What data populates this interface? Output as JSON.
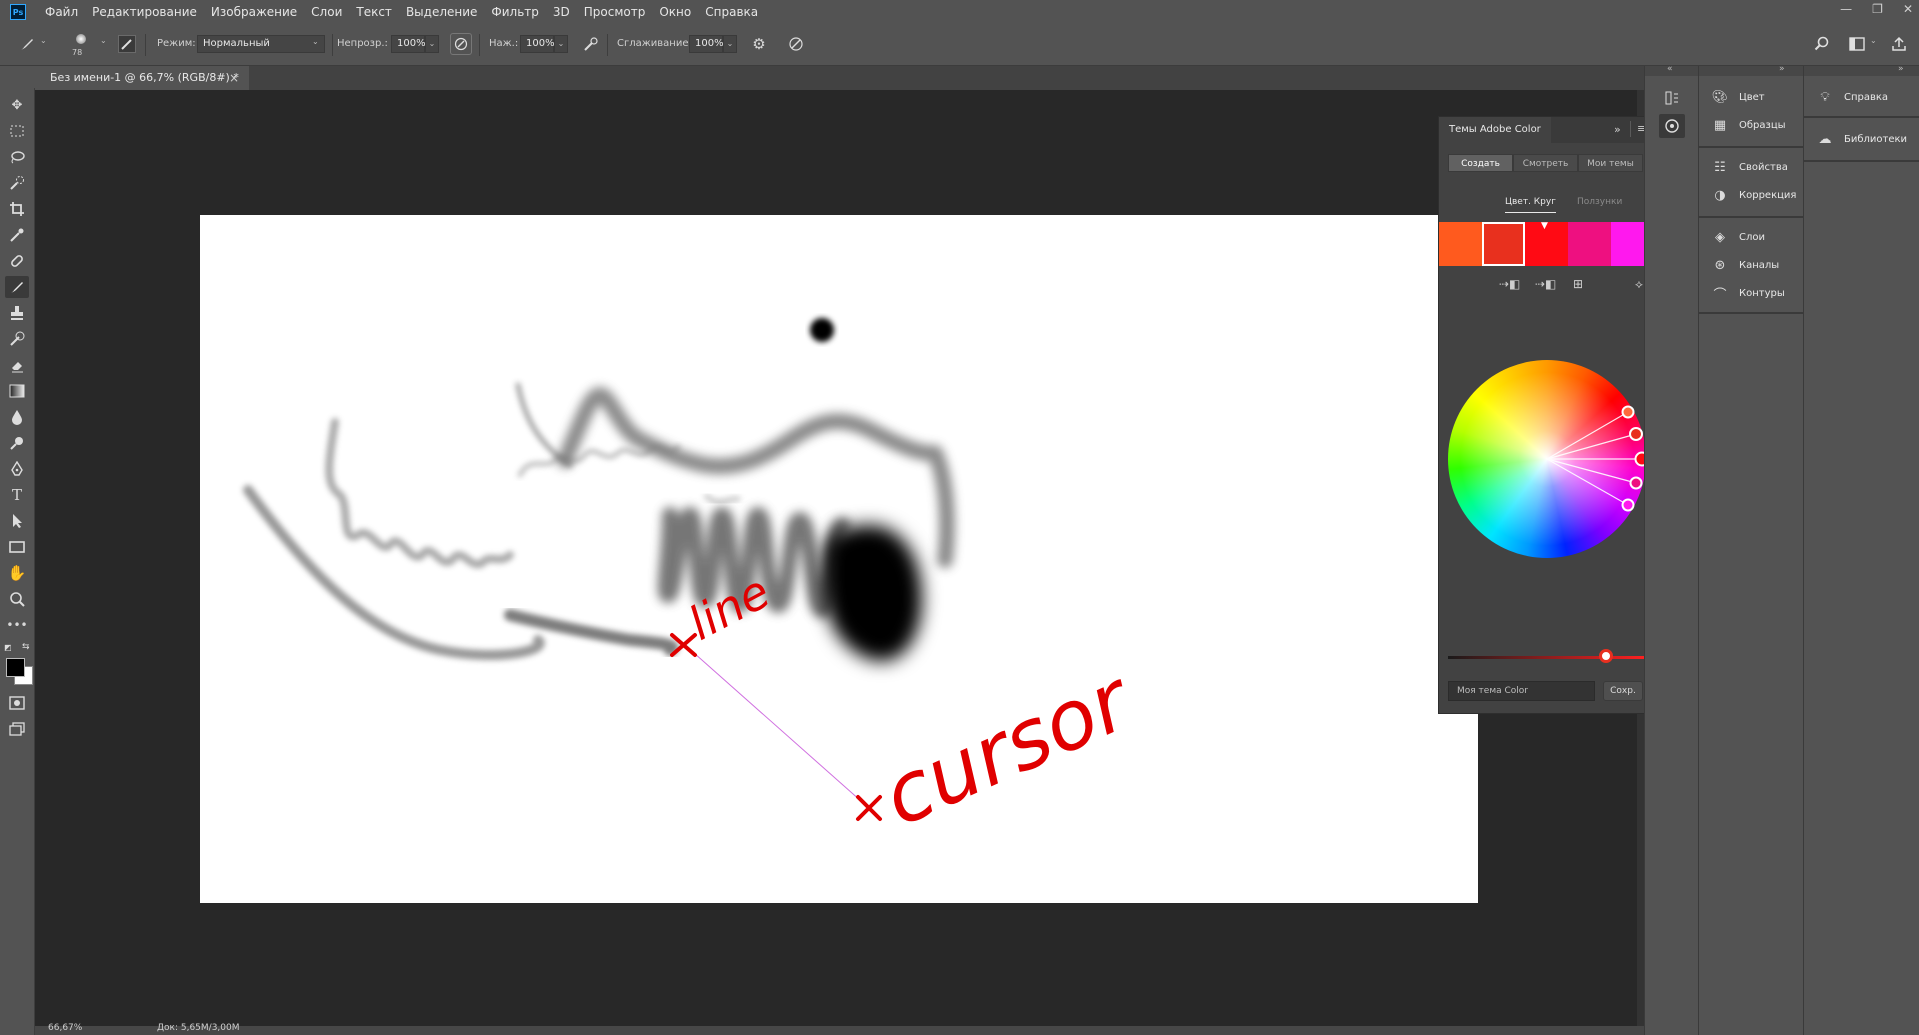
{
  "app": {
    "logo": "Ps"
  },
  "menubar": {
    "items": [
      "Файл",
      "Редактирование",
      "Изображение",
      "Слои",
      "Текст",
      "Выделение",
      "Фильтр",
      "3D",
      "Просмотр",
      "Окно",
      "Справка"
    ],
    "window_controls": [
      "—",
      "❐",
      "✕"
    ]
  },
  "options": {
    "brush_size": "78",
    "mode_label": "Режим:",
    "mode_value": "Нормальный",
    "opacity_label": "Непрозр.:",
    "opacity_value": "100%",
    "pressure_label": "Наж.:",
    "pressure_value": "100%",
    "smoothing_label": "Сглаживание:",
    "smoothing_value": "100%"
  },
  "document": {
    "tab_title": "Без имени-1 @ 66,7% (RGB/8#) *",
    "tab_close": "×",
    "zoom": "66,67%",
    "doc_info": "Док: 5,65M/3,00M",
    "annotations": [
      "line",
      "cursor"
    ]
  },
  "color_panel": {
    "title": "Темы Adobe Color",
    "tabs": [
      "Создать",
      "Смотреть",
      "Мои темы"
    ],
    "subtabs": [
      "Цвет. Круг",
      "Ползунки"
    ],
    "swatches": [
      "#ff5a1e",
      "#e8301e",
      "#ff0a14",
      "#ee1080",
      "#ff18ee"
    ],
    "theme_name_placeholder": "Моя тема Color",
    "save_label": "Сохр.",
    "brightness": 0.8
  },
  "panels_col1": [
    "Цвет",
    "Образцы",
    "Свойства",
    "Коррекция",
    "Слои",
    "Каналы",
    "Контуры"
  ],
  "panels_col2": [
    "Справка",
    "Библиотеки"
  ],
  "colors": {
    "ui_bg": "#535353",
    "canvas_bg": "#282828",
    "annotation": "#e00000",
    "guide_line": "#d070e0"
  }
}
